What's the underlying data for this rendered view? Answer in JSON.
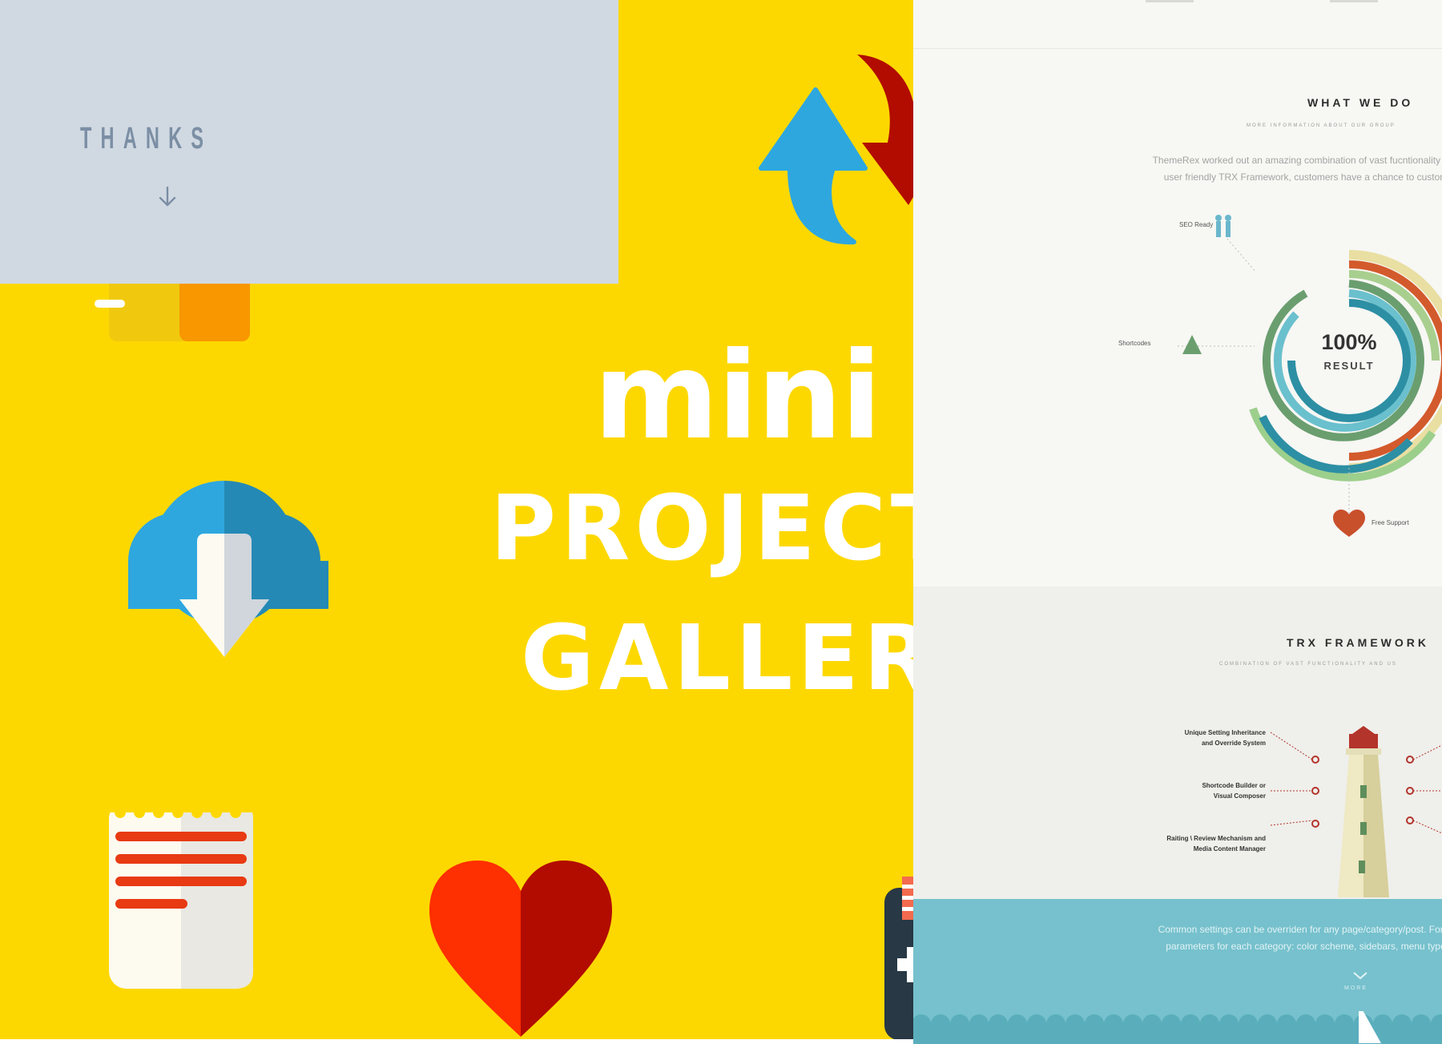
{
  "colors": {
    "yellow_background": "#fdd800",
    "card_background": "#d0d9e2",
    "blue": "#2ea7df",
    "dark_blue": "#2589b5",
    "red": "#fe2f00",
    "dark_red": "#b20c00",
    "orange": "#f89700",
    "navy": "#283845",
    "sea": "#76c1cd"
  },
  "thanks_card": {
    "title": "THANKS",
    "arrow_icon": "arrow-down-icon"
  },
  "hero": {
    "line1": "mini",
    "line2": "PROJECT",
    "line3": "GALLERY"
  },
  "icons": [
    "refresh-arrows-icon",
    "cloud-download-icon",
    "notepad-icon",
    "heart-icon",
    "calculator-icon",
    "folder-icon"
  ],
  "right_panel": {
    "what_we_do": {
      "title": "WHAT WE DO",
      "subtitle": "MORE INFORMATION ABOUT OUR GROUP",
      "body_line1": "ThemeRex worked out an amazing combination of vast fucntionality and",
      "body_line2": "user friendly TRX Framework, customers have a chance to custom"
    },
    "diagram": {
      "center_value": "100%",
      "center_label": "RESULT",
      "labels": {
        "seo": "SEO Ready",
        "shortcodes": "Shortcodes",
        "support": "Free Support"
      }
    },
    "trx_framework": {
      "title": "TRX FRAMEWORK",
      "subtitle": "COMBINATION OF VAST FUNCTIONALITY AND US",
      "features": [
        {
          "line1": "Unique Setting Inheritance",
          "line2": "and Override System"
        },
        {
          "line1": "Shortcode Builder or",
          "line2": "Visual Composer"
        },
        {
          "line1": "Raiting \\ Review Mechanism and",
          "line2": "Media Content Manager"
        }
      ]
    },
    "sea": {
      "line1": "Common settings can be overriden for any page/category/post. For in",
      "line2": "parameters for each category: color scheme, sidebars, menu type",
      "more": "MORE"
    }
  }
}
